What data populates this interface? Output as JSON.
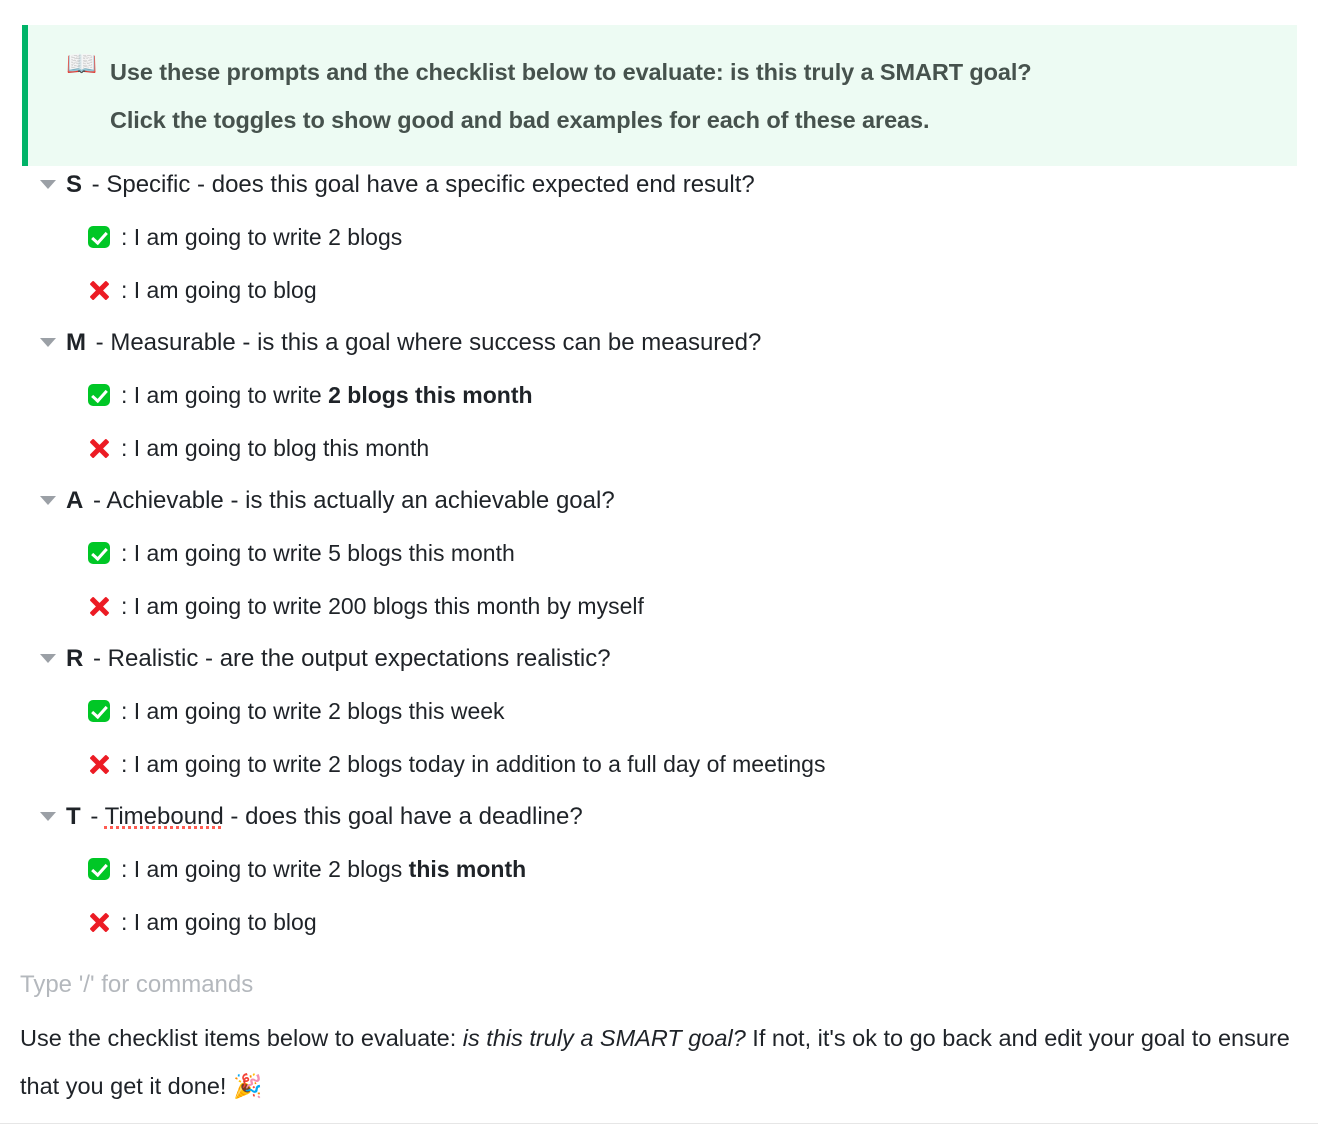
{
  "callout": {
    "icon": "📖",
    "icon_name": "open-book-icon",
    "accent_color": "#00b368",
    "background_color": "#edfbf3",
    "line1": "Use these prompts and the checklist below to evaluate: is this truly a SMART goal?",
    "line2": "Click the toggles to show good and bad examples for each of these areas."
  },
  "toggles": [
    {
      "letter": "S",
      "title_before": " - ",
      "keyword": "Specific",
      "title_after": " - does this goal have a specific expected end result?",
      "keyword_misspelled": false,
      "good": {
        "mark": "white-check-mark",
        "prefix": ": I am going to write 2 blogs",
        "bold": ""
      },
      "bad": {
        "mark": "cross-mark",
        "prefix": ": I am going to blog",
        "bold": ""
      }
    },
    {
      "letter": "M",
      "title_before": " - ",
      "keyword": "Measurable",
      "title_after": " - is this a goal where success can be measured?",
      "keyword_misspelled": false,
      "good": {
        "mark": "white-check-mark",
        "prefix": ": I am going to write ",
        "bold": "2 blogs this month"
      },
      "bad": {
        "mark": "cross-mark",
        "prefix": ": I am going to blog this month",
        "bold": ""
      }
    },
    {
      "letter": "A",
      "title_before": " - ",
      "keyword": "Achievable",
      "title_after": " - is this actually an achievable goal?",
      "keyword_misspelled": false,
      "good": {
        "mark": "white-check-mark",
        "prefix": ": I am going to write 5 blogs this month",
        "bold": ""
      },
      "bad": {
        "mark": "cross-mark",
        "prefix": ": I am going to write 200 blogs this month by myself",
        "bold": ""
      }
    },
    {
      "letter": "R",
      "title_before": " - ",
      "keyword": "Realistic",
      "title_after": " - are the output expectations realistic?",
      "keyword_misspelled": false,
      "good": {
        "mark": "white-check-mark",
        "prefix": ": I am going to write 2 blogs this week",
        "bold": ""
      },
      "bad": {
        "mark": "cross-mark",
        "prefix": ": I am going to write 2 blogs today in addition to a full day of meetings",
        "bold": ""
      }
    },
    {
      "letter": "T",
      "title_before": " - ",
      "keyword": "Timebound",
      "title_after": " - does this goal have a deadline?",
      "keyword_misspelled": true,
      "good": {
        "mark": "white-check-mark",
        "prefix": ": I am going to write 2 blogs ",
        "bold": "this month"
      },
      "bad": {
        "mark": "cross-mark",
        "prefix": ": I am going to blog",
        "bold": ""
      }
    }
  ],
  "editor": {
    "placeholder": "Type '/' for commands"
  },
  "closing": {
    "part1": "Use the checklist items below to evaluate: ",
    "italic": "is this truly a SMART goal?",
    "part2": " If not, it's ok to go back and edit your goal to ensure that you get it done! ",
    "emoji": "🎉"
  }
}
